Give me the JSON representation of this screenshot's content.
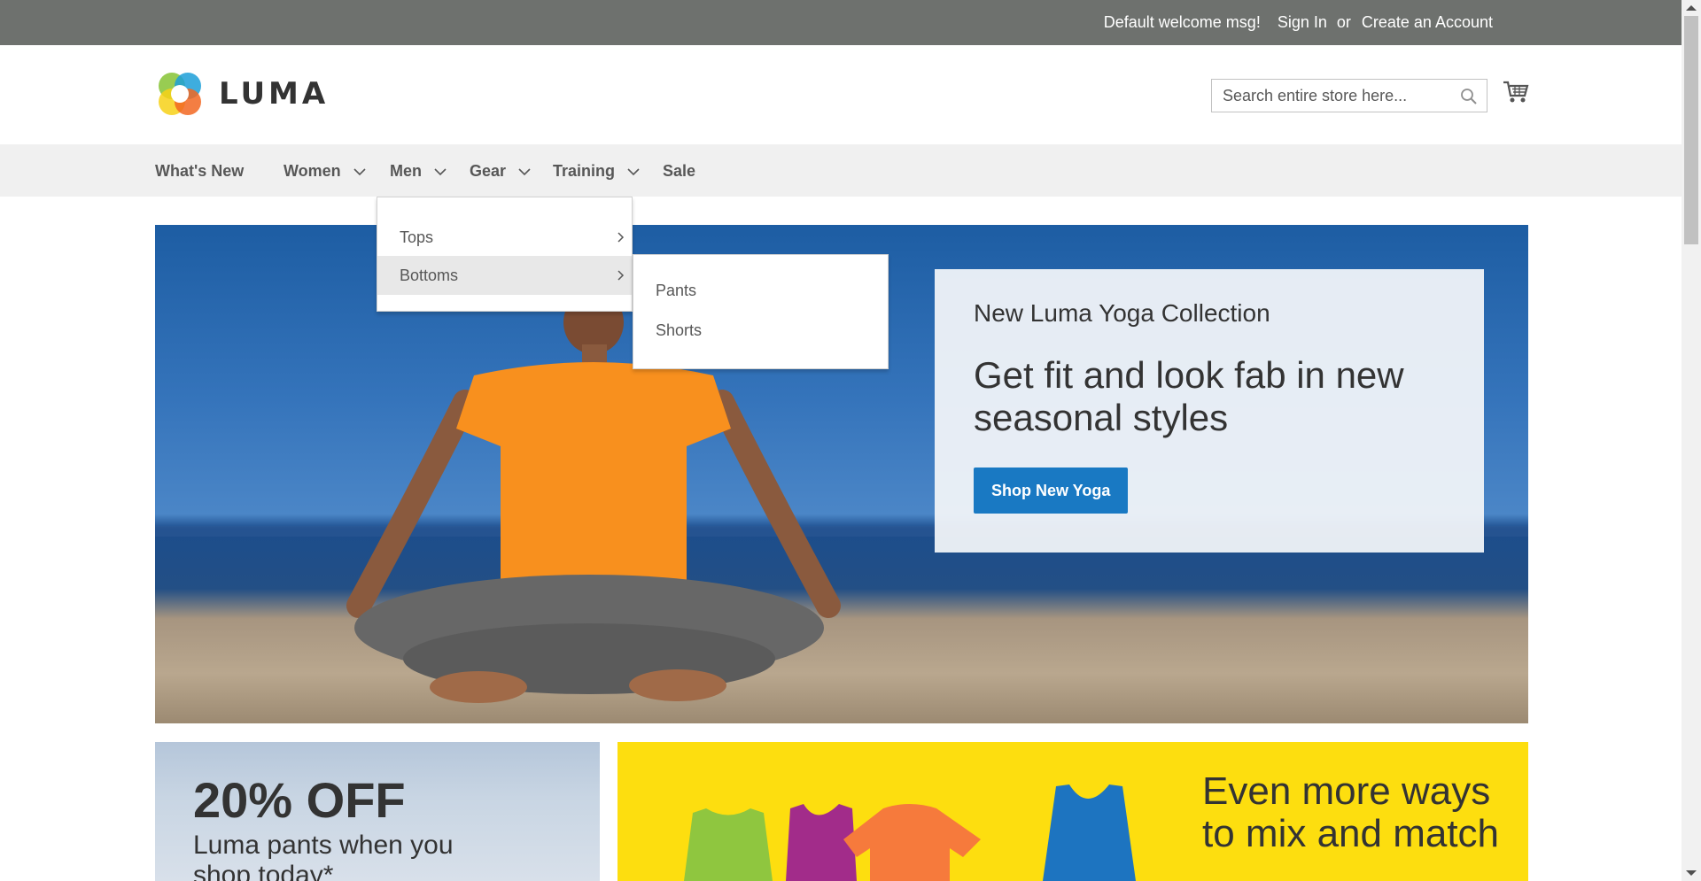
{
  "topbar": {
    "welcome": "Default welcome msg!",
    "sign_in": "Sign In",
    "or": "or",
    "create_account": "Create an Account"
  },
  "header": {
    "logo_text": "LUMA",
    "search_placeholder": "Search entire store here...",
    "search_icon": "search-icon",
    "cart_icon": "cart-icon"
  },
  "nav": {
    "items": [
      {
        "label": "What's New",
        "has_children": false
      },
      {
        "label": "Women",
        "has_children": true
      },
      {
        "label": "Men",
        "has_children": true
      },
      {
        "label": "Gear",
        "has_children": true
      },
      {
        "label": "Training",
        "has_children": true
      },
      {
        "label": "Sale",
        "has_children": false
      }
    ]
  },
  "dropdown": {
    "items": [
      {
        "label": "Tops",
        "active": false
      },
      {
        "label": "Bottoms",
        "active": true
      }
    ],
    "submenu": [
      "Pants",
      "Shorts"
    ]
  },
  "hero": {
    "subtitle": "New Luma Yoga Collection",
    "title": "Get fit and look fab in new seasonal styles",
    "button": "Shop New Yoga"
  },
  "tiles": {
    "left_offer": "20% OFF",
    "left_desc": "Luma pants when you shop today*",
    "right_heading": "Even more ways to mix and match"
  },
  "colors": {
    "topbar": "#6e716e",
    "accent": "#1979c3",
    "tile_yellow": "#fdde0f"
  }
}
